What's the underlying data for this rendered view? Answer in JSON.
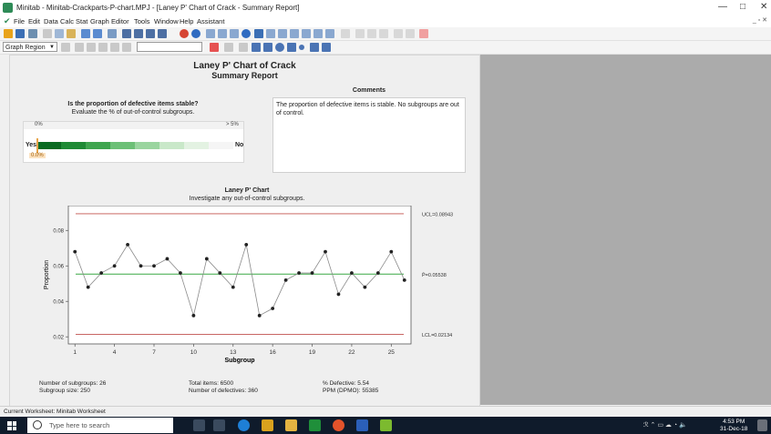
{
  "window": {
    "title": "Minitab - Minitab-Crackparts-P-chart.MPJ - [Laney P' Chart of Crack - Summary Report]",
    "controls": [
      "—",
      "□",
      "✕"
    ]
  },
  "menu": [
    "File",
    "Edit",
    "Data",
    "Calc",
    "Stat",
    "Graph",
    "Editor",
    "Tools",
    "Window",
    "Help",
    "Assistant"
  ],
  "toolbar": {
    "region_select": "Graph Region",
    "font_select": ""
  },
  "report": {
    "title": "Laney P' Chart of Crack",
    "subtitle": "Summary Report",
    "stability": {
      "question": "Is the proportion of defective items stable?",
      "instruction": "Evaluate the % of out-of-control subgroups.",
      "scale_min": "0%",
      "scale_max": "> 5%",
      "yes": "Yes",
      "no": "No",
      "marker": "0.0%"
    },
    "comments": {
      "heading": "Comments",
      "text": "The proportion of defective items is stable. No subgroups are out of control."
    },
    "chart_heading": "Laney P' Chart",
    "chart_instruction": "Investigate any out-of-control subgroups.",
    "stats": {
      "subgroups": "Number of subgroups: 26",
      "size": "Subgroup size: 250",
      "total": "Total items: 6500",
      "defectives": "Number of defectives: 360",
      "pct": "% Defective: 5.54",
      "ppm": "PPM (DPMO): 55385"
    }
  },
  "chart_data": {
    "type": "line",
    "xlabel": "Subgroup",
    "ylabel": "Proportion",
    "x": [
      1,
      2,
      3,
      4,
      5,
      6,
      7,
      8,
      9,
      10,
      11,
      12,
      13,
      14,
      15,
      16,
      17,
      18,
      19,
      20,
      21,
      22,
      23,
      24,
      25,
      26
    ],
    "values": [
      0.068,
      0.048,
      0.056,
      0.06,
      0.072,
      0.06,
      0.06,
      0.064,
      0.056,
      0.032,
      0.064,
      0.056,
      0.048,
      0.072,
      0.032,
      0.036,
      0.052,
      0.056,
      0.056,
      0.068,
      0.044,
      0.056,
      0.048,
      0.056,
      0.068,
      0.052
    ],
    "xticks": [
      "1",
      "4",
      "7",
      "10",
      "13",
      "16",
      "19",
      "22",
      "25"
    ],
    "yticks": [
      "0.02",
      "0.04",
      "0.06",
      "0.08"
    ],
    "ucl": 0.08943,
    "center": 0.05538,
    "lcl": 0.02134,
    "ucl_label": "UCL=0.08943",
    "center_label": "P̄=0.05538",
    "lcl_label": "LCL=0.02134",
    "ylim": [
      0.016,
      0.094
    ],
    "xlim": [
      0.5,
      26.5
    ],
    "colors": {
      "limits": "#c0504d",
      "center": "#3aa845",
      "line": "#8a8a8a",
      "points": "#222222"
    }
  },
  "status_bar": "Current Worksheet: Minitab Worksheet",
  "taskbar": {
    "search_placeholder": "Type here to search",
    "time": "4:53 PM",
    "date": "31-Dec-18"
  }
}
